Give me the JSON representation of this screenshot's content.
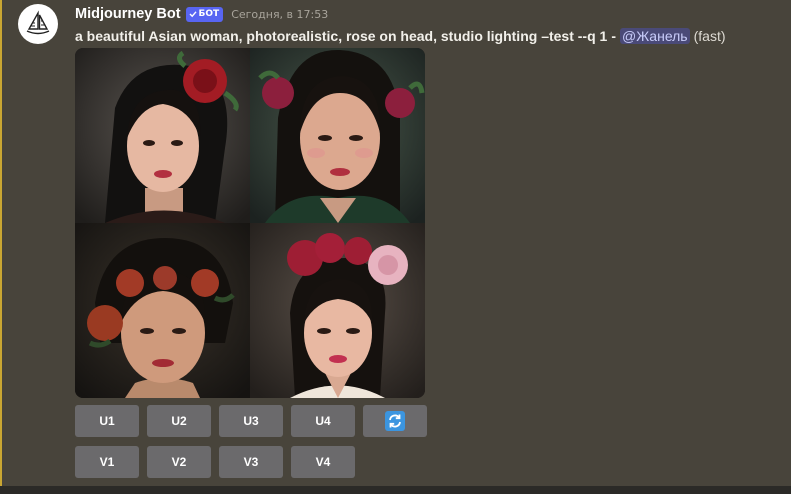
{
  "message": {
    "author": "Midjourney Bot",
    "bot_tag": "БОТ",
    "timestamp": "Сегодня, в 17:53",
    "prompt": "a beautiful Asian woman, photorealistic, rose on head, studio lighting –test --q 1",
    "separator": "-",
    "mention": "@Жанель",
    "mode": "(fast)"
  },
  "image_grid": {
    "tiles": [
      {
        "name": "portrait-1",
        "flower_color": "#a31c24"
      },
      {
        "name": "portrait-2",
        "flower_color": "#8c1f3d"
      },
      {
        "name": "portrait-3",
        "flower_color": "#9a3a22"
      },
      {
        "name": "portrait-4",
        "flower_color": "#9e1e34"
      }
    ]
  },
  "buttons": {
    "upscale": [
      "U1",
      "U2",
      "U3",
      "U4"
    ],
    "variation": [
      "V1",
      "V2",
      "V3",
      "V4"
    ],
    "reroll_icon": "refresh-icon"
  },
  "colors": {
    "background": "#48443b",
    "highlight": "#c9a632",
    "button": "#6b6a6c",
    "bot_tag": "#5865f2",
    "reroll_accent": "#3b95e0"
  }
}
